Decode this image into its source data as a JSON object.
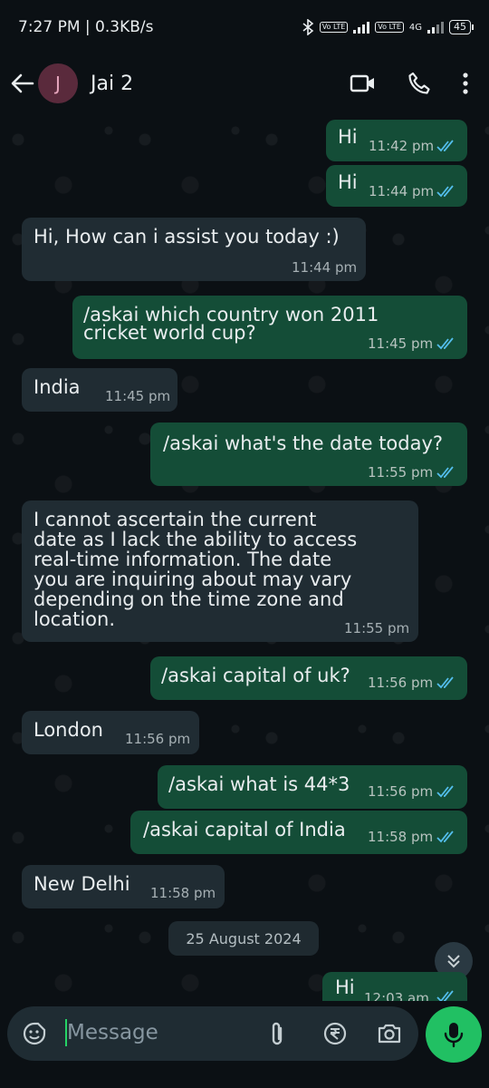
{
  "status": {
    "time": "7:27 PM | 0.3KB/s",
    "battery": "45",
    "lte1": "Vo LTE",
    "lte2": "Vo LTE",
    "net": "4G"
  },
  "header": {
    "avatar_letter": "J",
    "name": "Jai 2"
  },
  "messages": [
    {
      "dir": "out",
      "text": "Hi",
      "time": "11:42 pm"
    },
    {
      "dir": "out",
      "text": "Hi",
      "time": "11:44 pm"
    },
    {
      "dir": "in",
      "text": "Hi, How can i assist you today :)",
      "time": "11:44 pm"
    },
    {
      "dir": "out",
      "lines": [
        "/askai which country won 2011",
        "cricket world cup?"
      ],
      "time": "11:45 pm"
    },
    {
      "dir": "in",
      "text": "India",
      "time": "11:45 pm"
    },
    {
      "dir": "out",
      "text": "/askai what's the date today?",
      "time": "11:55 pm"
    },
    {
      "dir": "in",
      "lines": [
        "I cannot ascertain the current",
        "date as I lack the ability to access",
        "real-time information. The date",
        "you are inquiring about may vary",
        "depending on the time zone and",
        "location."
      ],
      "time": "11:55 pm"
    },
    {
      "dir": "out",
      "text": "/askai capital of uk?",
      "time": "11:56 pm"
    },
    {
      "dir": "in",
      "text": "London",
      "time": "11:56 pm"
    },
    {
      "dir": "out",
      "text": "/askai what is 44*3",
      "time": "11:56 pm"
    },
    {
      "dir": "out",
      "text": "/askai capital of India",
      "time": "11:58 pm"
    },
    {
      "dir": "in",
      "text": "New Delhi",
      "time": "11:58 pm"
    },
    {
      "dir": "out",
      "text": "Hi",
      "time": "12:03 am"
    }
  ],
  "date_divider": "25 August 2024",
  "composer": {
    "placeholder": "Message"
  },
  "colors": {
    "outgoing_bubble": "#144d37",
    "incoming_bubble": "#202c33",
    "read_ticks": "#53bdeb",
    "accent": "#21c063"
  }
}
